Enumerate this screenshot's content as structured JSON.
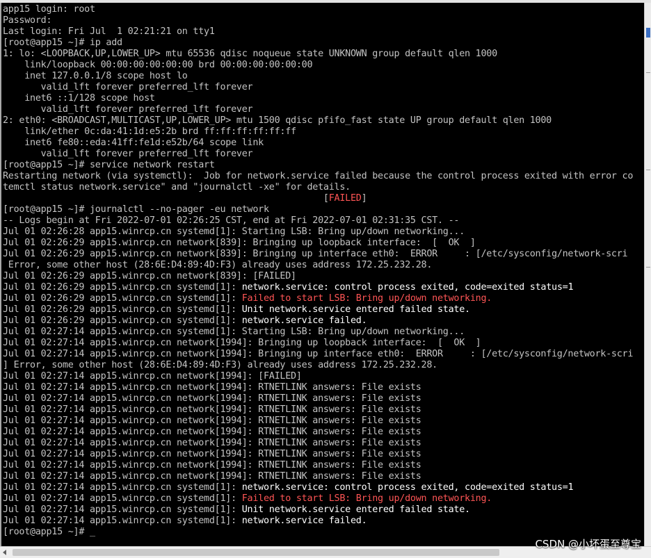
{
  "terminal": {
    "lines": [
      "app15 login: root",
      "Password:",
      "Last login: Fri Jul  1 02:21:21 on tty1",
      "[root@app15 ~]# ip add",
      "1: lo: <LOOPBACK,UP,LOWER_UP> mtu 65536 qdisc noqueue state UNKNOWN group default qlen 1000",
      "    link/loopback 00:00:00:00:00:00 brd 00:00:00:00:00:00",
      "    inet 127.0.0.1/8 scope host lo",
      "       valid_lft forever preferred_lft forever",
      "    inet6 ::1/128 scope host",
      "       valid_lft forever preferred_lft forever",
      "2: eth0: <BROADCAST,MULTICAST,UP,LOWER_UP> mtu 1500 qdisc pfifo_fast state UP group default qlen 1000",
      "    link/ether 0c:da:41:1d:e5:2b brd ff:ff:ff:ff:ff:ff",
      "    inet6 fe80::eda:41ff:fe1d:e52b/64 scope link",
      "       valid_lft forever preferred_lft forever",
      "[root@app15 ~]# service network restart",
      "Restarting network (via systemctl):  Job for network.service failed because the control process exited with error co",
      "temctl status network.service\" and \"journalctl -xe\" for details.",
      {
        "pre": "                                                           [",
        "red": "FAILED",
        "post": "]"
      },
      "[root@app15 ~]# journalctl --no-pager -eu network",
      "-- Logs begin at Fri 2022-07-01 02:26:25 CST, end at Fri 2022-07-01 02:31:35 CST. --",
      "Jul 01 02:26:28 app15.winrcp.cn systemd[1]: Starting LSB: Bring up/down networking...",
      "Jul 01 02:26:29 app15.winrcp.cn network[839]: Bringing up loopback interface:  [  OK  ]",
      "Jul 01 02:26:29 app15.winrcp.cn network[839]: Bringing up interface eth0:  ERROR     : [/etc/sysconfig/network-scri",
      " Error, some other host (28:6E:D4:89:4D:F3) already uses address 172.25.232.28.",
      "Jul 01 02:26:29 app15.winrcp.cn network[839]: [FAILED]",
      {
        "pre": "Jul 01 02:26:29 app15.winrcp.cn systemd[1]: ",
        "bright": "network.service: control process exited, code=exited status=1"
      },
      {
        "pre": "Jul 01 02:26:29 app15.winrcp.cn systemd[1]: ",
        "red": "Failed to start LSB: Bring up/down networking."
      },
      {
        "pre": "Jul 01 02:26:29 app15.winrcp.cn systemd[1]: ",
        "bright": "Unit network.service entered failed state."
      },
      {
        "pre": "Jul 01 02:26:29 app15.winrcp.cn systemd[1]: ",
        "bright": "network.service failed."
      },
      "Jul 01 02:27:14 app15.winrcp.cn systemd[1]: Starting LSB: Bring up/down networking...",
      "Jul 01 02:27:14 app15.winrcp.cn network[1994]: Bringing up loopback interface:  [  OK  ]",
      "Jul 01 02:27:14 app15.winrcp.cn network[1994]: Bringing up interface eth0:  ERROR     : [/etc/sysconfig/network-scri",
      "] Error, some other host (28:6E:D4:89:4D:F3) already uses address 172.25.232.28.",
      "Jul 01 02:27:14 app15.winrcp.cn network[1994]: [FAILED]",
      "Jul 01 02:27:14 app15.winrcp.cn network[1994]: RTNETLINK answers: File exists",
      "Jul 01 02:27:14 app15.winrcp.cn network[1994]: RTNETLINK answers: File exists",
      "Jul 01 02:27:14 app15.winrcp.cn network[1994]: RTNETLINK answers: File exists",
      "Jul 01 02:27:14 app15.winrcp.cn network[1994]: RTNETLINK answers: File exists",
      "Jul 01 02:27:14 app15.winrcp.cn network[1994]: RTNETLINK answers: File exists",
      "Jul 01 02:27:14 app15.winrcp.cn network[1994]: RTNETLINK answers: File exists",
      "Jul 01 02:27:14 app15.winrcp.cn network[1994]: RTNETLINK answers: File exists",
      "Jul 01 02:27:14 app15.winrcp.cn network[1994]: RTNETLINK answers: File exists",
      "Jul 01 02:27:14 app15.winrcp.cn network[1994]: RTNETLINK answers: File exists",
      {
        "pre": "Jul 01 02:27:14 app15.winrcp.cn systemd[1]: ",
        "bright": "network.service: control process exited, code=exited status=1"
      },
      {
        "pre": "Jul 01 02:27:14 app15.winrcp.cn systemd[1]: ",
        "red": "Failed to start LSB: Bring up/down networking."
      },
      {
        "pre": "Jul 01 02:27:14 app15.winrcp.cn systemd[1]: ",
        "bright": "Unit network.service entered failed state."
      },
      {
        "pre": "Jul 01 02:27:14 app15.winrcp.cn systemd[1]: ",
        "bright": "network.service failed."
      },
      "[root@app15 ~]# _"
    ]
  },
  "watermark": "CSDN @小坏蛋至尊宝",
  "colors": {
    "background": "#000000",
    "text": "#c3c3c3",
    "bright": "#ffffff",
    "error": "#ff5555"
  }
}
